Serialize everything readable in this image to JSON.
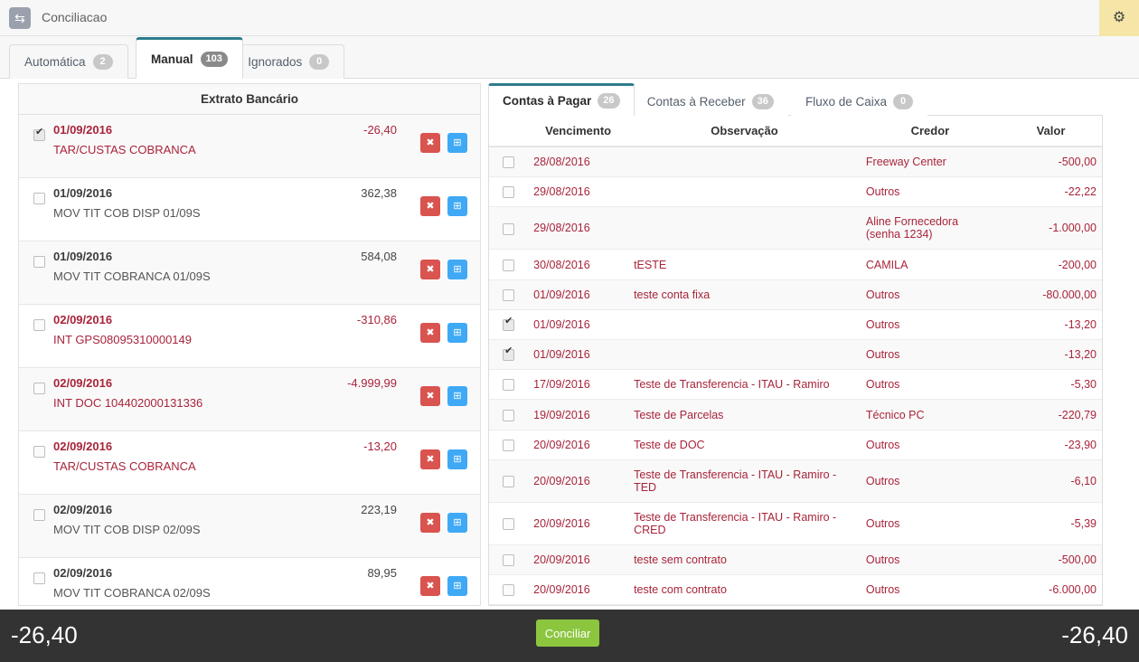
{
  "window": {
    "title": "Conciliacao",
    "app_icon": "sync-icon",
    "gear_icon": "gear-icon",
    "gear_bg": "#f5e6a8"
  },
  "main_tabs": [
    {
      "label": "Automática",
      "count": "2",
      "active": false
    },
    {
      "label": "Manual",
      "count": "103",
      "active": true
    },
    {
      "label": "Ignorados",
      "count": "0",
      "active": false
    }
  ],
  "left_panel": {
    "title": "Extrato Bancário",
    "row_buttons": {
      "remove_label": "✖",
      "add_label": "⊞"
    },
    "rows": [
      {
        "checked": true,
        "date": "01/09/2016",
        "description": "TAR/CUSTAS COBRANCA",
        "value": "-26,40",
        "negative": true
      },
      {
        "checked": false,
        "date": "01/09/2016",
        "description": "MOV TIT COB DISP 01/09S",
        "value": "362,38",
        "negative": false
      },
      {
        "checked": false,
        "date": "01/09/2016",
        "description": "MOV TIT COBRANCA 01/09S",
        "value": "584,08",
        "negative": false
      },
      {
        "checked": false,
        "date": "02/09/2016",
        "description": "INT GPS08095310000149",
        "value": "-310,86",
        "negative": true
      },
      {
        "checked": false,
        "date": "02/09/2016",
        "description": "INT DOC 104402000131336",
        "value": "-4.999,99",
        "negative": true
      },
      {
        "checked": false,
        "date": "02/09/2016",
        "description": "TAR/CUSTAS COBRANCA",
        "value": "-13,20",
        "negative": true
      },
      {
        "checked": false,
        "date": "02/09/2016",
        "description": "MOV TIT COB DISP 02/09S",
        "value": "223,19",
        "negative": false
      },
      {
        "checked": false,
        "date": "02/09/2016",
        "description": "MOV TIT COBRANCA 02/09S",
        "value": "89,95",
        "negative": false
      }
    ]
  },
  "right_panel": {
    "tabs": [
      {
        "label": "Contas à Pagar",
        "count": "26",
        "active": true
      },
      {
        "label": "Contas à Receber",
        "count": "36",
        "active": false
      },
      {
        "label": "Fluxo de Caixa",
        "count": "0",
        "active": false
      }
    ],
    "columns": [
      "",
      "Vencimento",
      "Observação",
      "Credor",
      "Valor"
    ],
    "rows": [
      {
        "checked": false,
        "vencimento": "28/08/2016",
        "observacao": "",
        "credor": "Freeway Center",
        "valor": "-500,00"
      },
      {
        "checked": false,
        "vencimento": "29/08/2016",
        "observacao": "",
        "credor": "Outros",
        "valor": "-22,22"
      },
      {
        "checked": false,
        "vencimento": "29/08/2016",
        "observacao": "",
        "credor": "Aline Fornecedora (senha 1234)",
        "valor": "-1.000,00"
      },
      {
        "checked": false,
        "vencimento": "30/08/2016",
        "observacao": "tESTE",
        "credor": "CAMILA",
        "valor": "-200,00"
      },
      {
        "checked": false,
        "vencimento": "01/09/2016",
        "observacao": "teste conta fixa",
        "credor": "Outros",
        "valor": "-80.000,00"
      },
      {
        "checked": true,
        "vencimento": "01/09/2016",
        "observacao": "",
        "credor": "Outros",
        "valor": "-13,20"
      },
      {
        "checked": true,
        "vencimento": "01/09/2016",
        "observacao": "",
        "credor": "Outros",
        "valor": "-13,20"
      },
      {
        "checked": false,
        "vencimento": "17/09/2016",
        "observacao": "Teste de Transferencia - ITAU - Ramiro",
        "credor": "Outros",
        "valor": "-5,30"
      },
      {
        "checked": false,
        "vencimento": "19/09/2016",
        "observacao": "Teste de Parcelas",
        "credor": "Técnico PC",
        "valor": "-220,79"
      },
      {
        "checked": false,
        "vencimento": "20/09/2016",
        "observacao": "Teste de DOC",
        "credor": "Outros",
        "valor": "-23,90"
      },
      {
        "checked": false,
        "vencimento": "20/09/2016",
        "observacao": "Teste de Transferencia - ITAU - Ramiro - TED",
        "credor": "Outros",
        "valor": "-6,10"
      },
      {
        "checked": false,
        "vencimento": "20/09/2016",
        "observacao": "Teste de Transferencia - ITAU - Ramiro - CRED",
        "credor": "Outros",
        "valor": "-5,39"
      },
      {
        "checked": false,
        "vencimento": "20/09/2016",
        "observacao": "teste sem contrato",
        "credor": "Outros",
        "valor": "-500,00"
      },
      {
        "checked": false,
        "vencimento": "20/09/2016",
        "observacao": "teste com contrato",
        "credor": "Outros",
        "valor": "-6.000,00"
      }
    ]
  },
  "footer": {
    "left_total": "-26,40",
    "right_total": "-26,40",
    "action_label": "Conciliar",
    "action_color": "#8cc63f"
  }
}
